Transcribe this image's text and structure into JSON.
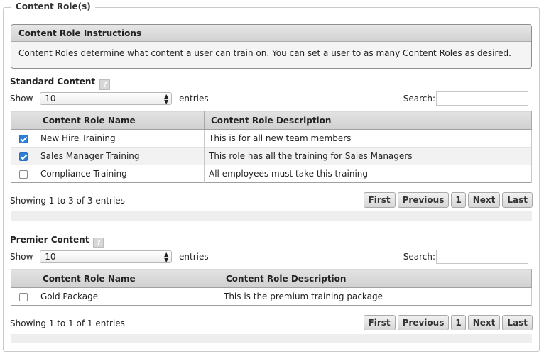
{
  "legend": "Content Role(s)",
  "instructions": {
    "title": "Content Role Instructions",
    "body": "Content Roles determine what content a user can train on. You can set a user to as many Content Roles as desired."
  },
  "standard": {
    "title": "Standard Content",
    "help": "?",
    "show_label": "Show",
    "length_value": "10",
    "entries_label": "entries",
    "search_label": "Search:",
    "search_value": "",
    "columns": [
      "",
      "Content Role Name",
      "Content Role Description"
    ],
    "rows": [
      {
        "checked": true,
        "name": "New Hire Training",
        "description": "This is for all new team members"
      },
      {
        "checked": true,
        "name": "Sales Manager Training",
        "description": "This role has all the training for Sales Managers"
      },
      {
        "checked": false,
        "name": "Compliance Training",
        "description": "All employees must take this training"
      }
    ],
    "info": "Showing 1 to 3 of 3 entries",
    "pager": {
      "first": "First",
      "previous": "Previous",
      "page": "1",
      "next": "Next",
      "last": "Last"
    }
  },
  "premier": {
    "title": "Premier Content",
    "help": "?",
    "show_label": "Show",
    "length_value": "10",
    "entries_label": "entries",
    "search_label": "Search:",
    "search_value": "",
    "columns": [
      "",
      "Content Role Name",
      "Content Role Description"
    ],
    "rows": [
      {
        "checked": false,
        "name": "Gold Package",
        "description": "This is the premium training package"
      }
    ],
    "info": "Showing 1 to 1 of 1 entries",
    "pager": {
      "first": "First",
      "previous": "Previous",
      "page": "1",
      "next": "Next",
      "last": "Last"
    }
  },
  "colors": {
    "checkbox_checked": "#2f7fd6",
    "header_bg": "#d9d9d9",
    "border": "#a0a0a0"
  }
}
